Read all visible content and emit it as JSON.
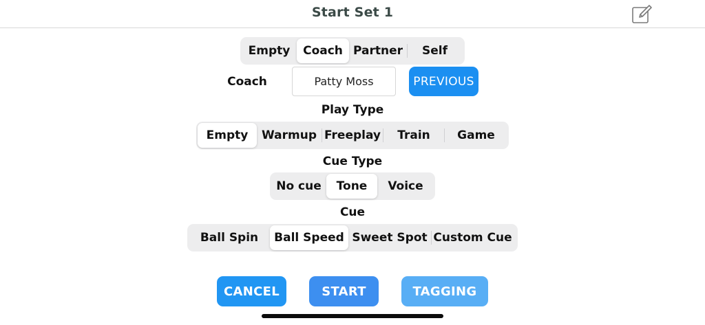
{
  "header": {
    "title": "Start Set 1"
  },
  "icons": {
    "edit": "edit-icon"
  },
  "source_selector": {
    "options": [
      "Empty",
      "Coach",
      "Partner",
      "Self"
    ],
    "selected": "Coach"
  },
  "coach": {
    "label": "Coach",
    "value": "Patty Moss",
    "previous_label": "PREVIOUS"
  },
  "play_type": {
    "label": "Play Type",
    "options": [
      "Empty",
      "Warmup",
      "Freeplay",
      "Train",
      "Game"
    ],
    "selected": "Empty"
  },
  "cue_type": {
    "label": "Cue Type",
    "options": [
      "No cue",
      "Tone",
      "Voice"
    ],
    "selected": "Tone"
  },
  "cue": {
    "label": "Cue",
    "options": [
      "Ball Spin",
      "Ball Speed",
      "Sweet Spot",
      "Custom Cue"
    ],
    "selected": "Ball Speed"
  },
  "actions": {
    "cancel_label": "CANCEL",
    "start_label": "START",
    "tagging_label": "TAGGING"
  },
  "colors": {
    "accent": "#2196f3",
    "title": "#3b4a47",
    "segment_bg": "#ededee"
  }
}
